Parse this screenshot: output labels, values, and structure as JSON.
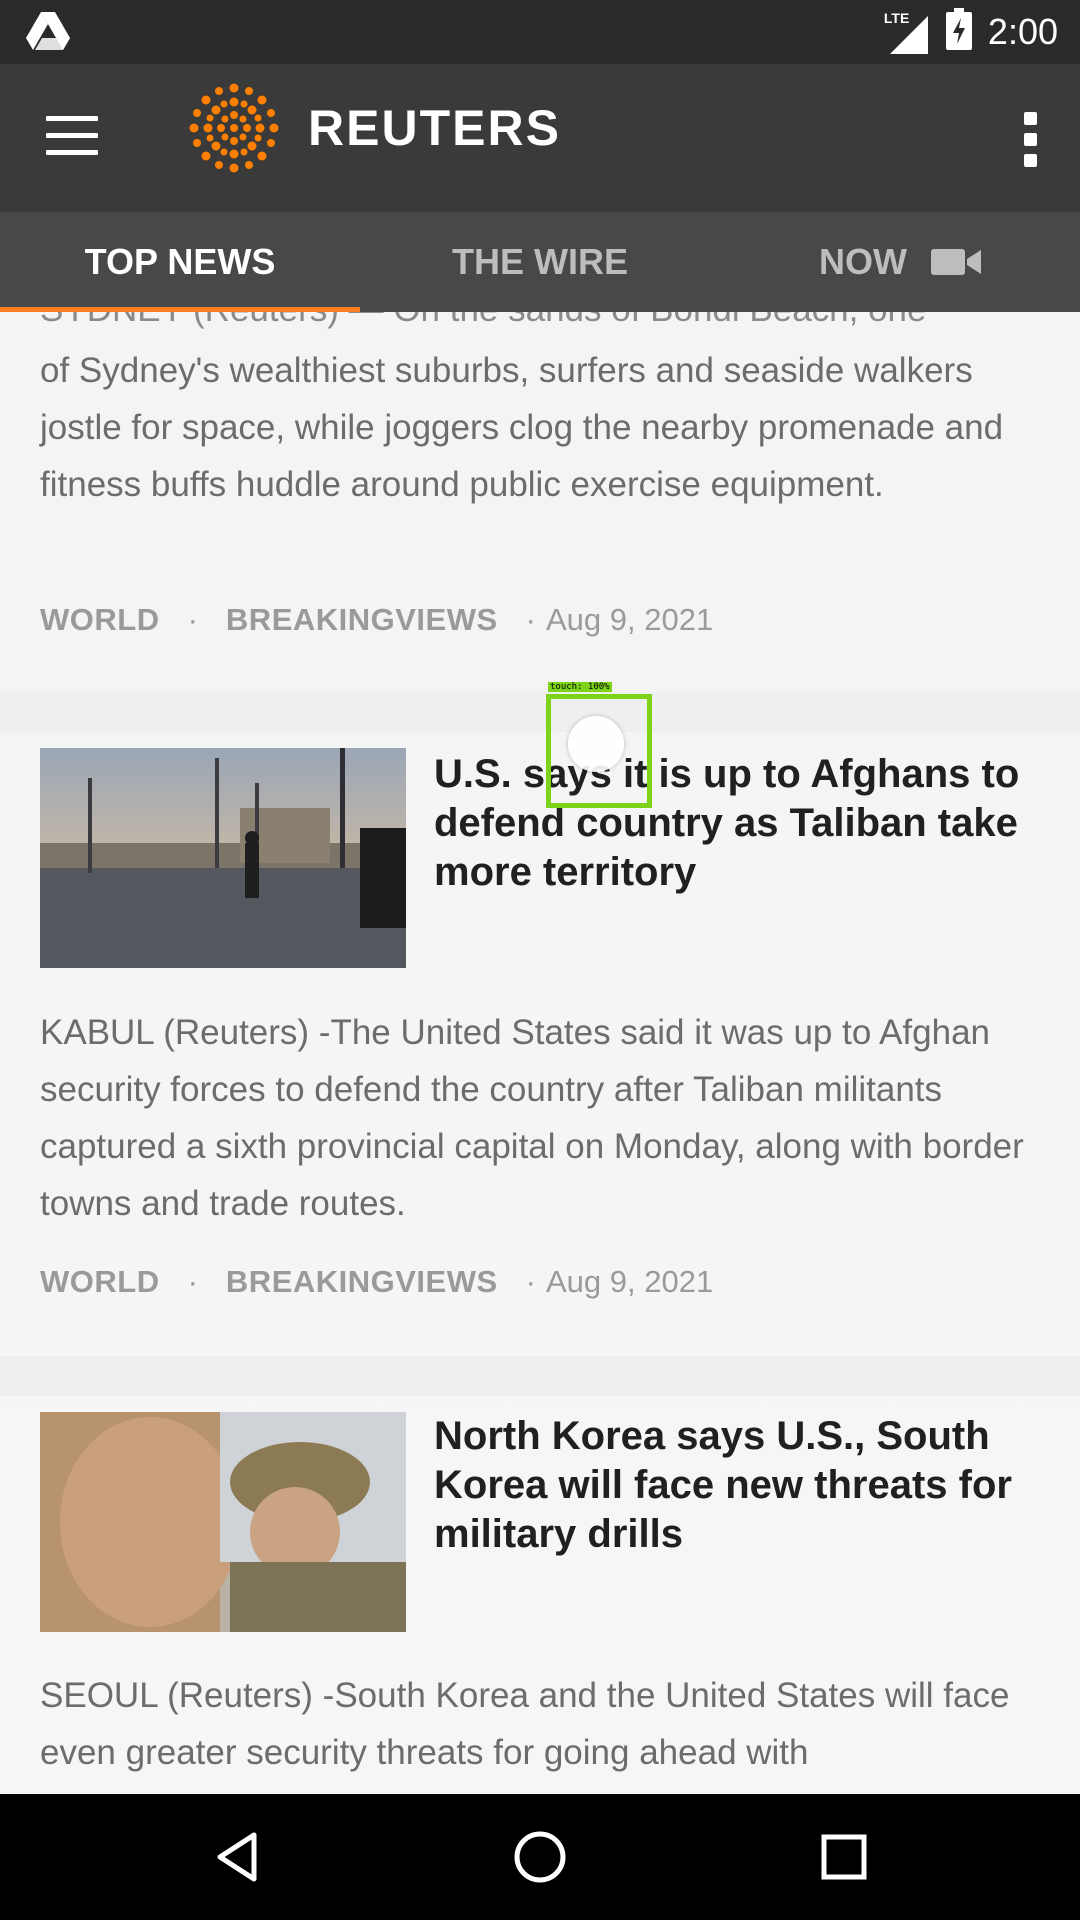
{
  "status_bar": {
    "network": "LTE",
    "time": "2:00",
    "icons": [
      "drive-icon",
      "signal-icon",
      "battery-charging-icon"
    ]
  },
  "app_bar": {
    "logo_text": "REUTERS",
    "menu_icon": "hamburger-icon",
    "overflow_icon": "more-vert-icon",
    "brand_color": "#ff8000"
  },
  "tabs": [
    {
      "label": "TOP NEWS",
      "active": true
    },
    {
      "label": "THE WIRE",
      "active": false
    },
    {
      "label": "NOW",
      "active": false,
      "icon": "video-camera-icon"
    }
  ],
  "accent_color": "#ff7f1e",
  "articles": [
    {
      "partial_lead": "SYDNEY (Reuters) — On the sands of Bondi Beach, one",
      "summary": "of Sydney's wealthiest suburbs, surfers and seaside walkers jostle for space, while joggers clog the nearby promenade and fitness buffs huddle around public exercise equipment.",
      "section": "WORLD",
      "subsection": "BREAKINGVIEWS",
      "date": "Aug 9, 2021"
    },
    {
      "headline": "U.S. says it is up to Afghans to defend country as Taliban take more territory",
      "summary": "KABUL (Reuters) -The United States said it was up to Afghan security forces to defend the country after Taliban militants captured a sixth provincial capital on Monday, along with border towns and trade routes.",
      "section": "WORLD",
      "subsection": "BREAKINGVIEWS",
      "date": "Aug 9, 2021"
    },
    {
      "headline": "North Korea says U.S., South Korea will face new threats for military drills",
      "summary": "SEOUL (Reuters) -South Korea and the United States will face even greater security threats for going ahead with"
    }
  ],
  "touch_indicator": {
    "label": "touch: 100%"
  },
  "nav_bar": {
    "icons": [
      "back-icon",
      "home-icon",
      "recents-icon"
    ]
  }
}
